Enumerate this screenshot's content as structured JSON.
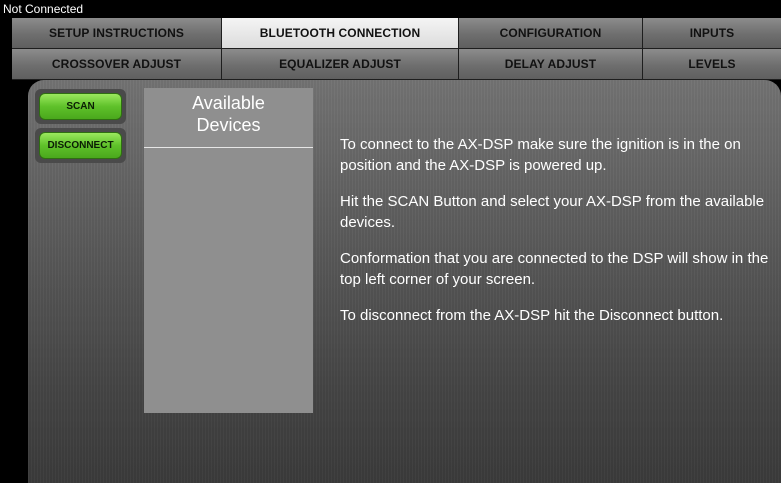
{
  "status": {
    "connection_text": "Not Connected"
  },
  "tabs_row1": [
    {
      "label": "SETUP INSTRUCTIONS",
      "active": false
    },
    {
      "label": "BLUETOOTH CONNECTION",
      "active": true
    },
    {
      "label": "CONFIGURATION",
      "active": false
    },
    {
      "label": "INPUTS",
      "active": false
    }
  ],
  "tabs_row2": [
    {
      "label": "CROSSOVER ADJUST",
      "active": false
    },
    {
      "label": "EQUALIZER ADJUST",
      "active": false
    },
    {
      "label": "DELAY ADJUST",
      "active": false
    },
    {
      "label": "LEVELS",
      "active": false
    }
  ],
  "buttons": {
    "scan_label": "SCAN",
    "disconnect_label": "DISCONNECT"
  },
  "devices": {
    "title_line1": "Available",
    "title_line2": "Devices",
    "items": []
  },
  "instructions": [
    "To connect to the AX-DSP make sure the ignition is in the on position and the AX-DSP is powered up.",
    "Hit the SCAN Button and select your AX-DSP from the available devices.",
    "Conformation that you are connected to the DSP will show in the top left corner of your screen.",
    "To disconnect from the AX-DSP hit the Disconnect button."
  ],
  "colors": {
    "accent_green": "#5fc12a",
    "active_tab": "#e8e8e8",
    "inactive_tab": "#6e6e6e"
  }
}
